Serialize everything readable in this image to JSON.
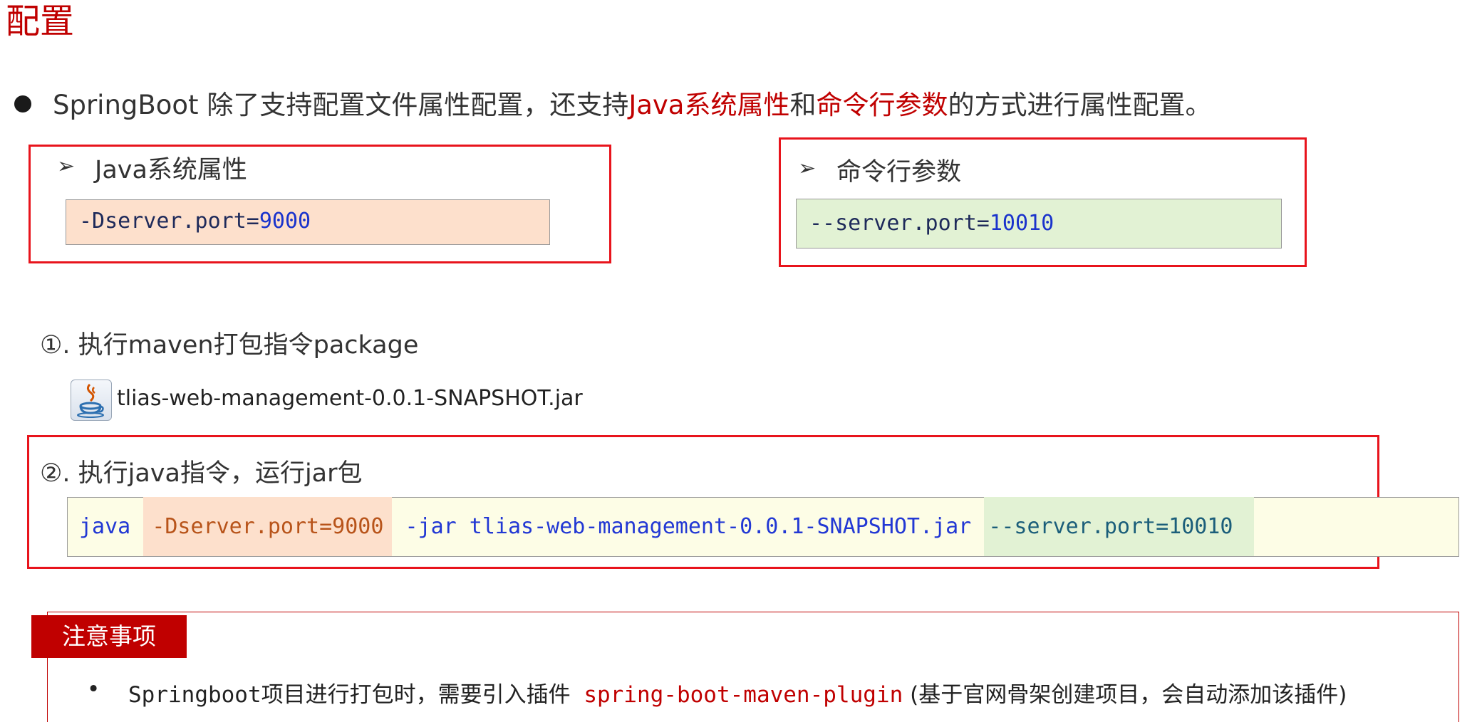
{
  "title": "配置",
  "intro": {
    "prefix": "SpringBoot 除了支持配置文件属性配置，还支持",
    "java_props": "Java系统属性",
    "and": "和",
    "cmd_args": "命令行参数",
    "suffix": "的方式进行属性配置。"
  },
  "java_box": {
    "arrow": "➢",
    "label": "Java系统属性",
    "code_key": "-Dserver.port=",
    "code_val": "9000"
  },
  "cmd_box": {
    "arrow": "➢",
    "label": "命令行参数",
    "code_key": "--server.port=",
    "code_val": "10010"
  },
  "step1": {
    "label": "①. 执行maven打包指令package",
    "jar_name": "tlias-web-management-0.0.1-SNAPSHOT.jar",
    "icon": "java-jar-icon"
  },
  "step2": {
    "label": "②. 执行java指令，运行jar包",
    "cmd_java": "java ",
    "cmd_dprop": "-Dserver.port=9000",
    "cmd_jar": " -jar tlias-web-management-0.0.1-SNAPSHOT.jar ",
    "cmd_arg": "--server.port=10010"
  },
  "notice": {
    "tag": "注意事项",
    "bullet": "•",
    "text_prefix": "Springboot项目进行打包时，需要引入插件 ",
    "plugin": "spring-boot-maven-plugin",
    "text_suffix": " (基于官网骨架创建项目，会自动添加该插件)"
  },
  "colors": {
    "accent_red": "#c00000",
    "box_red": "#e8141c",
    "java_bg": "#fde0cc",
    "cmd_bg": "#e2f2d4",
    "cmd_line_bg": "#fdfde6"
  }
}
